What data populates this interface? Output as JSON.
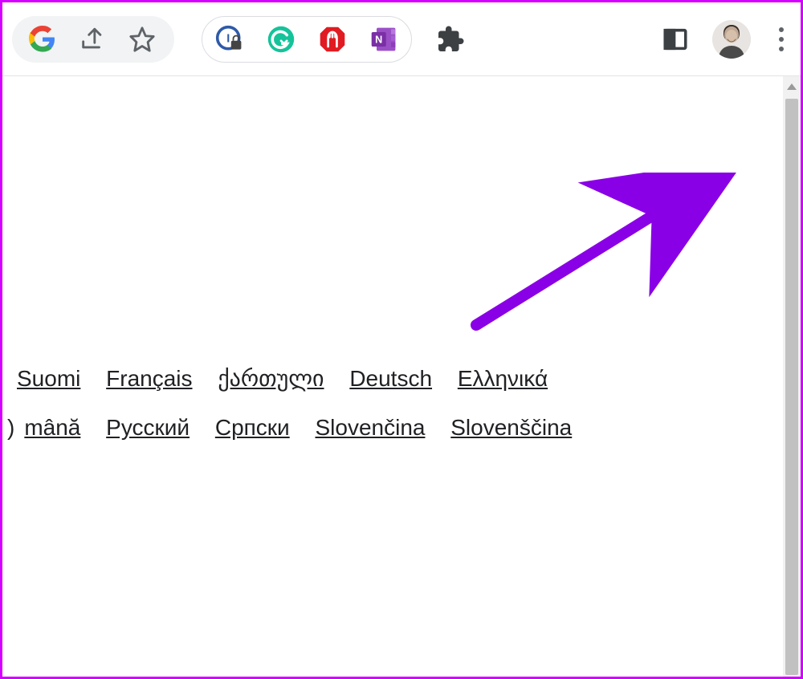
{
  "languages": {
    "row1": [
      "Suomi",
      "Français",
      "ქართული",
      "Deutsch",
      "Ελληνικά"
    ],
    "row2": [
      "mână",
      "Русский",
      "Српски",
      "Slovenčina",
      "Slovenščina"
    ]
  },
  "row2_prefix": ")",
  "icons": {
    "google": "google-icon",
    "share": "share-icon",
    "star": "star-icon",
    "ext1": "clock-lock-icon",
    "ext2": "grammarly-icon",
    "ext3": "adblock-icon",
    "ext4": "onenote-icon",
    "puzzle": "extensions-icon",
    "panel": "side-panel-icon",
    "avatar": "profile-avatar",
    "menu": "kebab-menu-icon"
  }
}
